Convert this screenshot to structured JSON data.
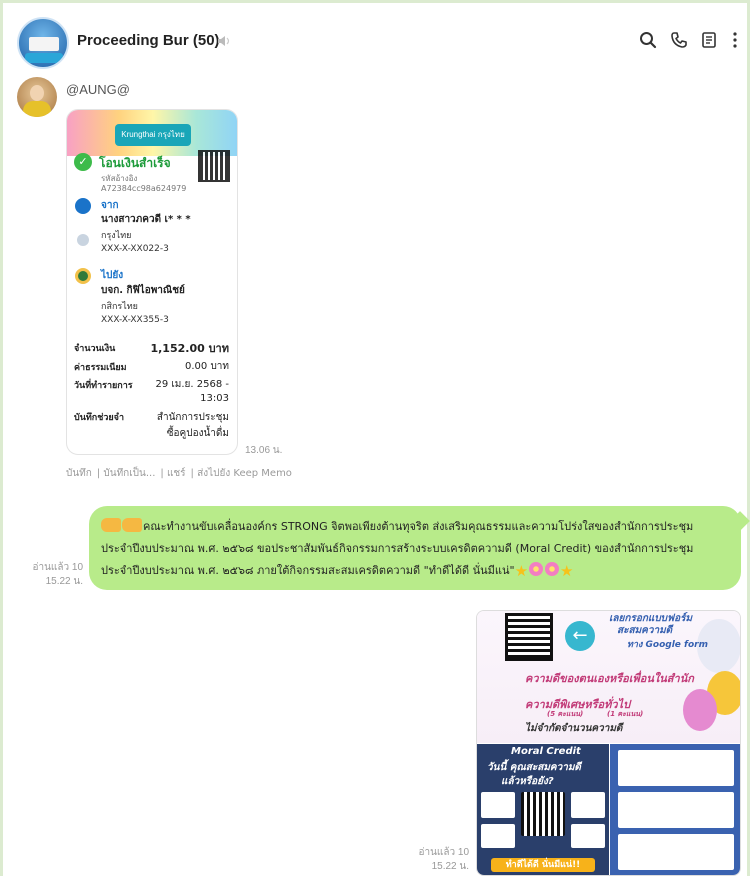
{
  "header": {
    "title": "Proceeding Bur",
    "member_count": "(50)",
    "icons": [
      "search-icon",
      "phone-icon",
      "notes-icon",
      "more-icon"
    ]
  },
  "left_message": {
    "sender": "@AUNG@",
    "time": "13.06 น.",
    "slip": {
      "bank": "Krungthai",
      "bank_th": "กรุงไทย",
      "status": "โอนเงินสำเร็จ",
      "ref_label": "รหัสอ้างอิง",
      "ref": "A72384cc98a624979",
      "from_label": "จาก",
      "from_name": "นางสาวภควดี เ* * *",
      "from_bank": "กรุงไทย",
      "from_account": "XXX-X-XX022-3",
      "to_label": "ไปยัง",
      "to_name": "บจก. กิฟิไอพาณิชย์",
      "to_bank": "กสิกรไทย",
      "to_account": "XXX-X-XX355-3",
      "amount_label": "จำนวนเงิน",
      "amount": "1,152.00 บาท",
      "fee_label": "ค่าธรรมเนียม",
      "fee": "0.00 บาท",
      "date_label": "วันที่ทำรายการ",
      "date": "29 เม.ย. 2568 -",
      "date_time": "13:03",
      "memo_label": "บันทึกช่วยจำ",
      "memo_line1": "สำนักการประชุม",
      "memo_line2": "ซื้อคูปองน้ำดื่ม"
    },
    "actions": [
      "บันทึก",
      "บันทึกเป็น...",
      "แชร์",
      "ส่งไปยัง Keep Memo"
    ]
  },
  "right_message": {
    "read": "อ่านแล้ว 10",
    "time": "15.22 น.",
    "line1": "คณะทำงานขับเคลื่อนองค์กร STRONG จิตพอเพียงต้านทุจริต ส่งเสริมคุณธรรมและความโปร่งใสของสำนักการประชุม",
    "line2": "ประจำปีงบประมาณ พ.ศ. ๒๕๖๘ ขอประชาสัมพันธ์กิจกรรมการสร้างระบบเครดิตความดี (Moral Credit) ของสำนักการประชุม",
    "line3": "ประจำปีงบประมาณ พ.ศ. ๒๕๖๘ ภายใต้กิจกรรมสะสมเครดิตความดี \"ทำดีได้ดี นั่นมีแน่\""
  },
  "image_message": {
    "read": "อ่านแล้ว 10",
    "time": "15.22 น.",
    "poster": {
      "top_text1": "เลยกรอกแบบฟอร์ม",
      "top_text2": "สะสมความดี",
      "top_text3": "ทาง Google form",
      "row1": "ความดีของตนเองหรือเพื่อนในสำนัก",
      "row2": "ความดีพิเศษหรือทั่วไป",
      "row2_sub_a": "(5 คะแนน)",
      "row2_sub_b": "(1 คะแนน)",
      "row3": "ไม่จำกัดจำนวนความดี",
      "moral_credit": "Moral Credit",
      "question1": "วันนี้ คุณสะสมความดี",
      "question2": "แล้วหรือยัง?",
      "slogan": "ทำดีได้ดี นั่นมีแน่!!"
    }
  }
}
